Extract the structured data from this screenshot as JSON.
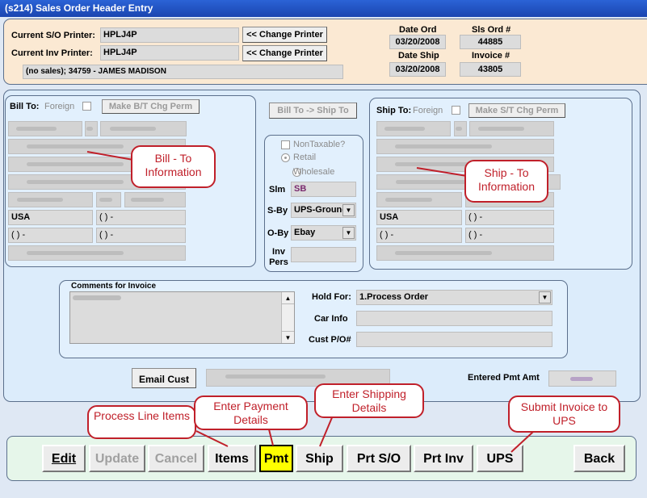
{
  "window": {
    "title": "(s214)  Sales Order Header Entry"
  },
  "printers": {
    "so_label": "Current S/O Printer:",
    "so_value": "HPLJ4P",
    "inv_label": "Current Inv Printer:",
    "inv_value": "HPLJ4P",
    "change_label": "<< Change Printer",
    "customer_line": "(no sales); 34759 - JAMES MADISON"
  },
  "order_info": {
    "date_ord_label": "Date Ord",
    "date_ord": "03/20/2008",
    "sls_ord_label": "Sls Ord #",
    "sls_ord": "44885",
    "date_ship_label": "Date Ship",
    "date_ship": "03/20/2008",
    "invoice_label": "Invoice #",
    "invoice": "43805"
  },
  "bill_to": {
    "label": "Bill To:",
    "foreign_label": "Foreign",
    "make_perm_label": "Make B/T Chg Perm",
    "country": "USA",
    "phone1": "(   )    -",
    "phone2": "(   )    -",
    "phone3": "(   )    -"
  },
  "ship_to": {
    "label": "Ship To:",
    "foreign_label": "Foreign",
    "make_perm_label": "Make S/T Chg Perm",
    "country": "USA",
    "phone1": "(   )    -",
    "phone2": "(   )    -",
    "phone3": "(   )    -"
  },
  "middle": {
    "copy_button": "Bill To -> Ship To",
    "nontaxable": "NonTaxable?",
    "retail": "Retail",
    "wholesale": "Wholesale",
    "slm_label": "Slm",
    "slm_value": "SB",
    "sby_label": "S-By",
    "sby_value": "UPS-Ground",
    "oby_label": "O-By",
    "oby_value": "Ebay",
    "inv_pers_label": "Inv Pers"
  },
  "comments": {
    "label": "Comments for Invoice",
    "hold_for_label": "Hold For:",
    "hold_for_value": "1.Process Order",
    "car_info_label": "Car Info",
    "cust_po_label": "Cust P/O#"
  },
  "email": {
    "button": "Email Cust",
    "entered_pmt_label": "Entered Pmt Amt"
  },
  "buttons": {
    "edit": "Edit",
    "update": "Update",
    "cancel": "Cancel",
    "items": "Items",
    "pmt": "Pmt",
    "ship": "Ship",
    "prt_so": "Prt S/O",
    "prt_inv": "Prt Inv",
    "ups": "UPS",
    "back": "Back"
  },
  "callouts": {
    "bill_to": "Bill - To Information",
    "ship_to": "Ship - To Information",
    "items": "Process Line Items",
    "pmt": "Enter Payment Details",
    "ship": "Enter Shipping Details",
    "ups": "Submit Invoice to UPS"
  },
  "colors": {
    "callout": "#c0202a",
    "pmt_highlight": "#ffff00",
    "slm_value": "#7a2a6e"
  }
}
